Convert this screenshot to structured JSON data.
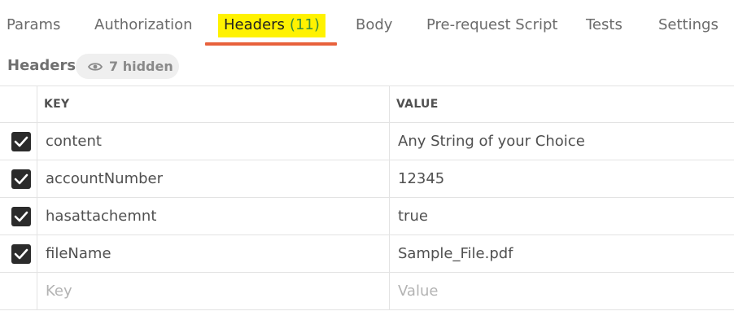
{
  "tabs": [
    {
      "label": "Params",
      "count": ""
    },
    {
      "label": "Authorization",
      "count": ""
    },
    {
      "label": "Headers",
      "count": "(11)"
    },
    {
      "label": "Body",
      "count": ""
    },
    {
      "label": "Pre-request Script",
      "count": ""
    },
    {
      "label": "Tests",
      "count": ""
    },
    {
      "label": "Settings",
      "count": ""
    }
  ],
  "active_tab": "Headers",
  "section": {
    "title": "Headers",
    "hidden_toggle": "7 hidden",
    "hidden_icon": "eye-icon"
  },
  "table": {
    "columns": [
      "KEY",
      "VALUE"
    ],
    "rows": [
      {
        "checked": true,
        "key": "content",
        "value": "Any String of your Choice"
      },
      {
        "checked": true,
        "key": "accountNumber",
        "value": "12345"
      },
      {
        "checked": true,
        "key": "hasattachemnt",
        "value": "true"
      },
      {
        "checked": true,
        "key": "fileName",
        "value": "Sample_File.pdf"
      }
    ],
    "new_row": {
      "key_placeholder": "Key",
      "value_placeholder": "Value"
    }
  },
  "colors": {
    "active_underline": "#e8613c",
    "highlight": "#fff200",
    "count_text": "#3b8d3b",
    "checkbox": "#2b2b2b"
  }
}
